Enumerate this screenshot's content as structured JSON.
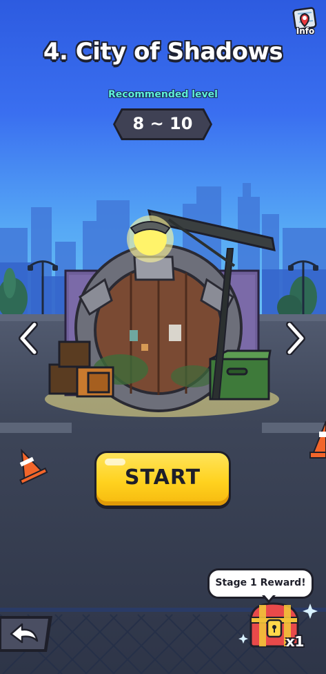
{
  "stage": {
    "title": "4. City of Shadows",
    "recommended_label": "Recommended level",
    "recommended_range": "8 ~ 10"
  },
  "header": {
    "info_label": "Info",
    "info_icon": "map-pin-icon"
  },
  "navigation": {
    "prev_icon": "chevron-left-icon",
    "next_icon": "chevron-right-icon",
    "back_icon": "back-arrow-icon"
  },
  "actions": {
    "start_label": "START"
  },
  "reward": {
    "label": "Stage 1 Reward!",
    "count": "x1",
    "icon": "treasure-chest-icon"
  },
  "colors": {
    "accent_yellow": "#ffd21f",
    "recommended_teal": "#5ef0d8",
    "pill_dark": "#3f4154",
    "outline": "#1e1f2a"
  }
}
